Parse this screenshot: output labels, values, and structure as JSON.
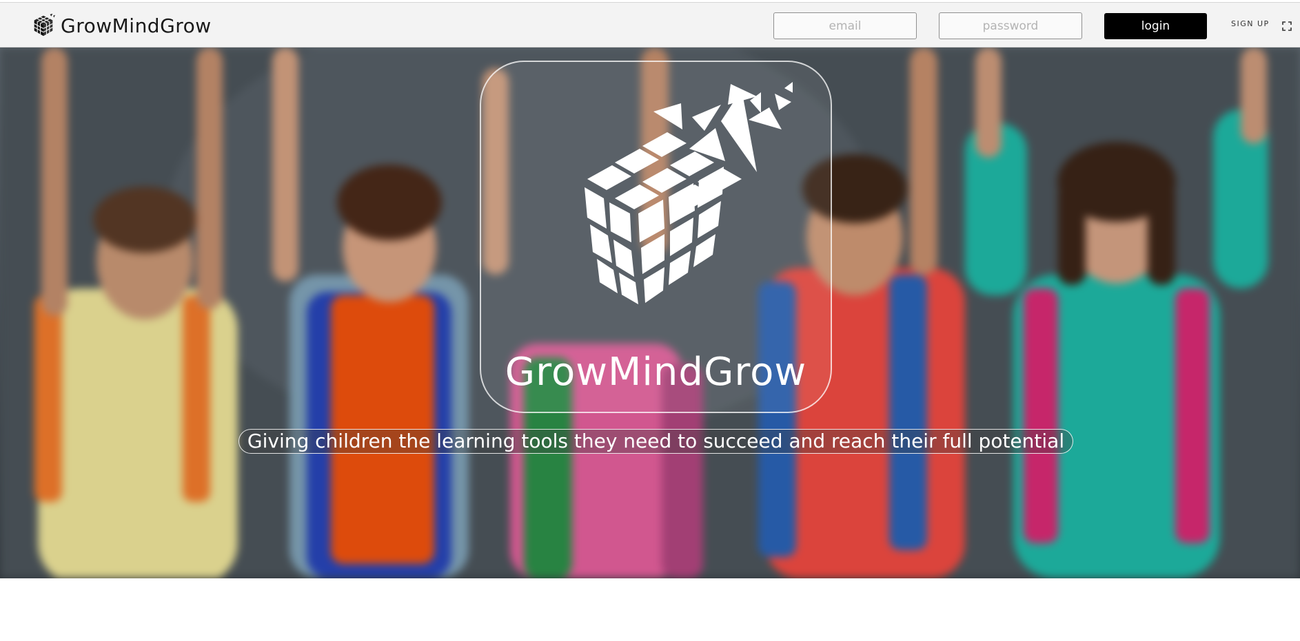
{
  "header": {
    "brand_name": "GrowMindGrow",
    "brand_icon": "cube-logo-icon",
    "email_placeholder": "email",
    "password_placeholder": "password",
    "login_label": "login",
    "signup_label": "SIGN UP",
    "fullscreen_icon": "fullscreen-icon"
  },
  "hero": {
    "title": "GrowMindGrow",
    "tagline": "Giving children the learning tools they need to succeed and reach their full potential",
    "logo_icon": "cube-logo-icon"
  },
  "colors": {
    "navbar_bg": "#f3f3f3",
    "login_button_bg": "#000000",
    "hero_text": "#ffffff"
  }
}
